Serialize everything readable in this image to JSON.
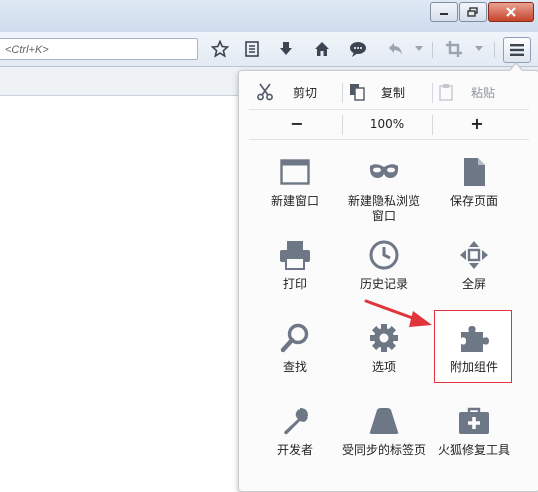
{
  "window": {
    "minimize_icon": "minimize-icon",
    "maximize_icon": "restore-icon",
    "close_icon": "close-icon"
  },
  "toolbar": {
    "url_placeholder": "<Ctrl+K>",
    "icons": [
      "star-icon",
      "reading-list-icon",
      "download-icon",
      "home-icon",
      "chat-icon",
      "undo-icon",
      "dropdown-icon",
      "crop-icon",
      "dropdown-icon",
      "hamburger-menu-icon"
    ]
  },
  "panel": {
    "edit": {
      "cut": "剪切",
      "copy": "复制",
      "paste": "粘贴"
    },
    "zoom": {
      "minus": "−",
      "level": "100%",
      "plus": "+"
    },
    "items": [
      {
        "label": "新建窗口",
        "icon": "new-window-icon"
      },
      {
        "label": "新建隐私浏览窗口",
        "icon": "private-mask-icon"
      },
      {
        "label": "保存页面",
        "icon": "save-page-icon"
      },
      {
        "label": "打印",
        "icon": "printer-icon"
      },
      {
        "label": "历史记录",
        "icon": "history-clock-icon"
      },
      {
        "label": "全屏",
        "icon": "fullscreen-icon"
      },
      {
        "label": "查找",
        "icon": "magnifier-icon"
      },
      {
        "label": "选项",
        "icon": "gear-icon"
      },
      {
        "label": "附加组件",
        "icon": "puzzle-addon-icon"
      },
      {
        "label": "开发者",
        "icon": "wrench-icon"
      },
      {
        "label": "受同步的标签页",
        "icon": "synced-tabs-icon"
      },
      {
        "label": "火狐修复工具",
        "icon": "repair-toolkit-icon"
      }
    ]
  },
  "colors": {
    "icon": "#6d7785",
    "highlight": "#e0353a"
  }
}
